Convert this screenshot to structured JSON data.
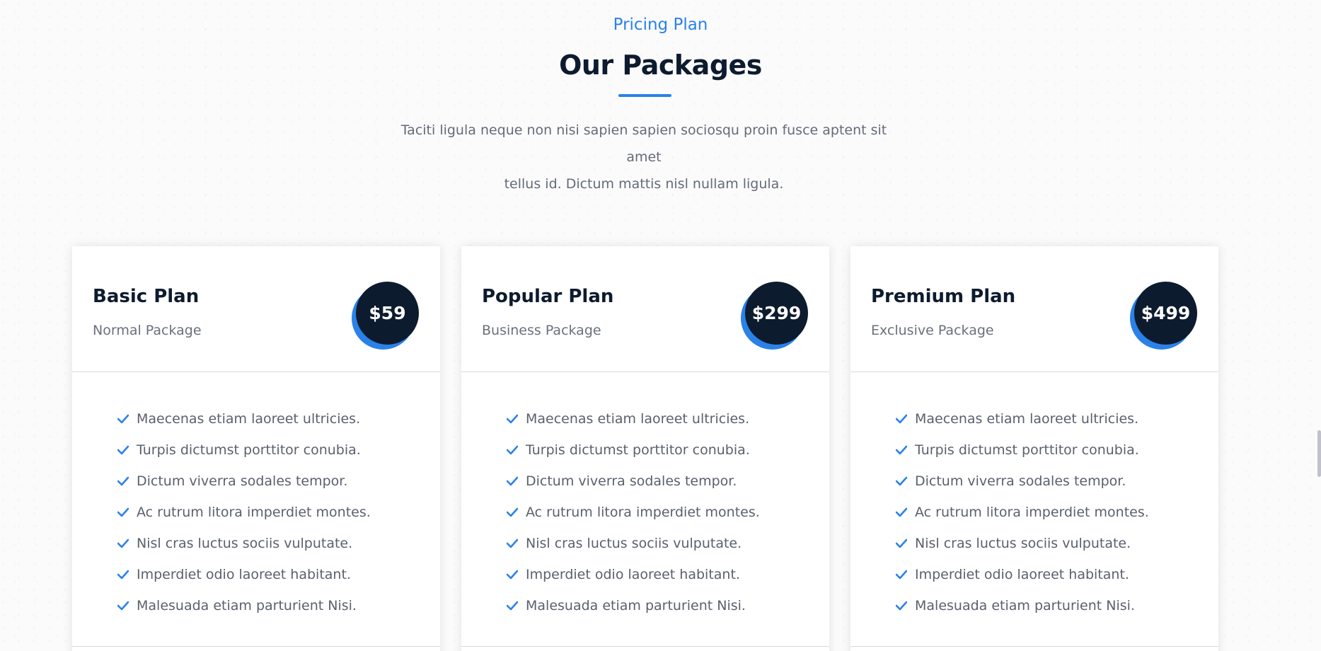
{
  "section": {
    "eyebrow": "Pricing Plan",
    "heading": "Our Packages",
    "intro_line1": "Taciti ligula neque non nisi sapien sapien sociosqu proin fusce aptent sit amet",
    "intro_line2": "tellus id. Dictum mattis nisl nullam ligula."
  },
  "colors": {
    "accent": "#2a82e8",
    "dark": "#0d1b2e"
  },
  "plans": [
    {
      "title": "Basic Plan",
      "subtitle": "Normal Package",
      "price": "$59",
      "features": [
        "Maecenas etiam laoreet ultricies.",
        "Turpis dictumst porttitor conubia.",
        "Dictum viverra sodales tempor.",
        "Ac rutrum litora imperdiet montes.",
        "Nisl cras luctus sociis vulputate.",
        "Imperdiet odio laoreet habitant.",
        "Malesuada etiam parturient Nisi."
      ]
    },
    {
      "title": "Popular Plan",
      "subtitle": "Business Package",
      "price": "$299",
      "features": [
        "Maecenas etiam laoreet ultricies.",
        "Turpis dictumst porttitor conubia.",
        "Dictum viverra sodales tempor.",
        "Ac rutrum litora imperdiet montes.",
        "Nisl cras luctus sociis vulputate.",
        "Imperdiet odio laoreet habitant.",
        "Malesuada etiam parturient Nisi."
      ]
    },
    {
      "title": "Premium Plan",
      "subtitle": "Exclusive Package",
      "price": "$499",
      "features": [
        "Maecenas etiam laoreet ultricies.",
        "Turpis dictumst porttitor conubia.",
        "Dictum viverra sodales tempor.",
        "Ac rutrum litora imperdiet montes.",
        "Nisl cras luctus sociis vulputate.",
        "Imperdiet odio laoreet habitant.",
        "Malesuada etiam parturient Nisi."
      ]
    }
  ],
  "icons": {
    "feature": "check-icon"
  }
}
